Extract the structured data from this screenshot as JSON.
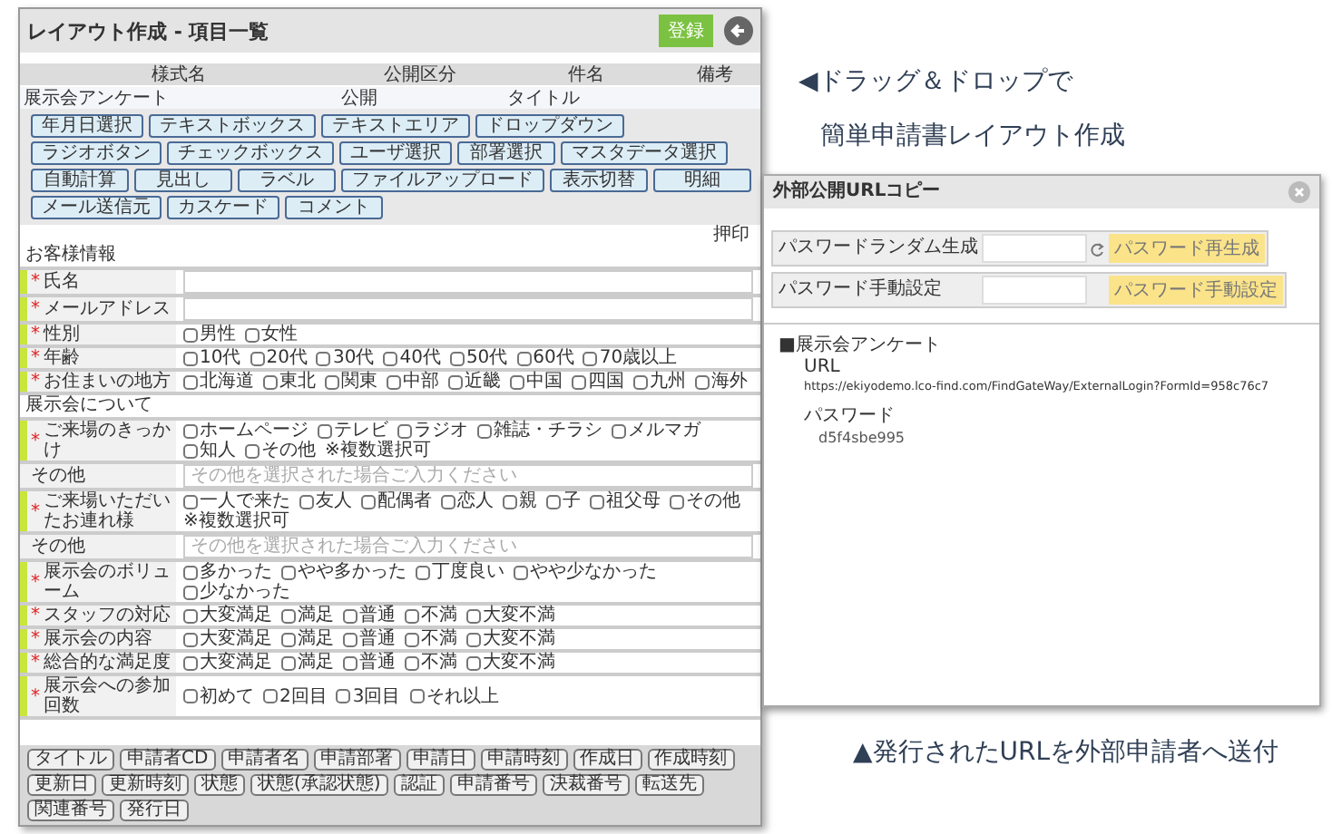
{
  "captions": [
    "◀ドラッグ＆ドロップで",
    "簡単申請書レイアウト作成"
  ],
  "editor": {
    "title": "レイアウト作成 - 項目一覧",
    "save_button": "登録",
    "header_table": {
      "columns": [
        "様式名",
        "公開区分",
        "件名",
        "備考"
      ],
      "row": [
        "展示会アンケート",
        "公開",
        "タイトル"
      ]
    },
    "palette": [
      "年月日選択",
      "テキストボックス",
      "テキストエリア",
      "ドロップダウン",
      "ラジオボタン",
      "チェックボックス",
      "ユーザ選択",
      "部署選択",
      "マスタデータ選択",
      "自動計算",
      "見出し",
      "ラベル",
      "ファイルアップロード",
      "表示切替",
      "明細",
      "メール送信元",
      "カスケード",
      "コメント"
    ],
    "stamp_label": "押印",
    "required_mark": "*",
    "sections": [
      {
        "title": "お客様情報",
        "rows": [
          {
            "label": "氏名",
            "required": true,
            "kind": "input"
          },
          {
            "label": "メールアドレス",
            "required": true,
            "kind": "input"
          },
          {
            "label": "性別",
            "required": true,
            "kind": "checks",
            "options": [
              {
                "label": "男性",
                "checked": false
              },
              {
                "label": "女性",
                "checked": false
              }
            ]
          },
          {
            "label": "年齢",
            "required": true,
            "kind": "checks",
            "options": [
              {
                "label": "10代",
                "checked": false
              },
              {
                "label": "20代",
                "checked": false
              },
              {
                "label": "30代",
                "checked": false
              },
              {
                "label": "40代",
                "checked": false
              },
              {
                "label": "50代",
                "checked": false
              },
              {
                "label": "60代",
                "checked": false
              },
              {
                "label": "70歳以上",
                "checked": false
              }
            ]
          },
          {
            "label": "お住まいの地方",
            "required": true,
            "kind": "checks",
            "options": [
              {
                "label": "北海道",
                "checked": false
              },
              {
                "label": "東北",
                "checked": false
              },
              {
                "label": "関東",
                "checked": false
              },
              {
                "label": "中部",
                "checked": false
              },
              {
                "label": "近畿",
                "checked": false
              },
              {
                "label": "中国",
                "checked": false
              },
              {
                "label": "四国",
                "checked": false
              },
              {
                "label": "九州",
                "checked": false
              },
              {
                "label": "海外",
                "checked": false
              }
            ]
          }
        ]
      },
      {
        "title": "展示会について",
        "rows": [
          {
            "label": "ご来場のきっかけ",
            "required": true,
            "kind": "checks",
            "options": [
              {
                "label": "ホームページ",
                "checked": false
              },
              {
                "label": "テレビ",
                "checked": false
              },
              {
                "label": "ラジオ",
                "checked": false
              },
              {
                "label": "雑誌・チラシ",
                "checked": false
              },
              {
                "label": "メルマガ",
                "checked": false
              },
              {
                "label": "知人",
                "checked": false
              },
              {
                "label": "その他",
                "checked": false
              }
            ],
            "note": "※複数選択可"
          },
          {
            "label": "その他",
            "required": false,
            "kind": "input",
            "placeholder": "その他を選択された場合ご入力ください"
          },
          {
            "label": "ご来場いただいたお連れ様",
            "required": true,
            "kind": "checks",
            "options": [
              {
                "label": "一人で来た",
                "checked": false
              },
              {
                "label": "友人",
                "checked": false
              },
              {
                "label": "配偶者",
                "checked": false
              },
              {
                "label": "恋人",
                "checked": false
              },
              {
                "label": "親",
                "checked": false
              },
              {
                "label": "子",
                "checked": false
              },
              {
                "label": "祖父母",
                "checked": false
              },
              {
                "label": "その他",
                "checked": false
              }
            ],
            "note": "※複数選択可"
          },
          {
            "label": "その他",
            "required": false,
            "kind": "input",
            "placeholder": "その他を選択された場合ご入力ください"
          },
          {
            "label": "展示会のボリューム",
            "required": true,
            "kind": "checks",
            "options": [
              {
                "label": "多かった",
                "checked": false
              },
              {
                "label": "やや多かった",
                "checked": false
              },
              {
                "label": "丁度良い",
                "checked": false
              },
              {
                "label": "やや少なかった",
                "checked": false
              },
              {
                "label": "少なかった",
                "checked": false
              }
            ]
          },
          {
            "label": "スタッフの対応",
            "required": true,
            "kind": "checks",
            "options": [
              {
                "label": "大変満足",
                "checked": false
              },
              {
                "label": "満足",
                "checked": false
              },
              {
                "label": "普通",
                "checked": false
              },
              {
                "label": "不満",
                "checked": false
              },
              {
                "label": "大変不満",
                "checked": false
              }
            ]
          },
          {
            "label": "展示会の内容",
            "required": true,
            "kind": "checks",
            "options": [
              {
                "label": "大変満足",
                "checked": false
              },
              {
                "label": "満足",
                "checked": false
              },
              {
                "label": "普通",
                "checked": false
              },
              {
                "label": "不満",
                "checked": false
              },
              {
                "label": "大変不満",
                "checked": false
              }
            ]
          },
          {
            "label": "総合的な満足度",
            "required": true,
            "kind": "checks",
            "options": [
              {
                "label": "大変満足",
                "checked": false
              },
              {
                "label": "満足",
                "checked": false
              },
              {
                "label": "普通",
                "checked": false
              },
              {
                "label": "不満",
                "checked": false
              },
              {
                "label": "大変不満",
                "checked": false
              }
            ]
          },
          {
            "label": "展示会への参加回数",
            "required": true,
            "kind": "checks",
            "options": [
              {
                "label": "初めて",
                "checked": false
              },
              {
                "label": "2回目",
                "checked": false
              },
              {
                "label": "3回目",
                "checked": false
              },
              {
                "label": "それ以上",
                "checked": false
              }
            ]
          }
        ]
      }
    ],
    "field_chips": [
      "タイトル",
      "申請者CD",
      "申請者名",
      "申請部署",
      "申請日",
      "申請時刻",
      "作成日",
      "作成時刻",
      "更新日",
      "更新時刻",
      "状態",
      "状態(承認状態)",
      "認証",
      "申請番号",
      "決裁番号",
      "転送先",
      "関連番号",
      "発行日"
    ]
  },
  "dialog": {
    "title": "外部公開URLコピー",
    "password_rows": [
      {
        "label": "パスワードランダム生成",
        "button": "パスワード再生成",
        "kind": "random"
      },
      {
        "label": "パスワード手動設定",
        "button": "パスワード手動設定",
        "kind": "manual"
      }
    ],
    "form_name": "■展示会アンケート",
    "url_label": "URL",
    "url": "https://ekiyodemo.lco-find.com/FindGateWay/ExternalLogin?FormId=958c76c7",
    "password_label": "パスワード",
    "password": "d5f4sbe995"
  },
  "bottom_caption": "▲発行されたURLを外部申請者へ送付"
}
